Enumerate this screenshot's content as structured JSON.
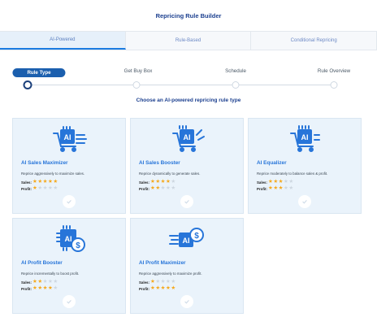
{
  "page_title": "Repricing Rule Builder",
  "tabs": [
    {
      "label": "AI-Powered",
      "active": true
    },
    {
      "label": "Rule-Based",
      "active": false
    },
    {
      "label": "Conditional Repricing",
      "active": false
    }
  ],
  "steps": [
    {
      "label": "Rule Type",
      "active": true
    },
    {
      "label": "Get Buy Box",
      "active": false
    },
    {
      "label": "Schedule",
      "active": false
    },
    {
      "label": "Rule Overview",
      "active": false
    }
  ],
  "subtitle": "Choose an AI-powered repricing rule type",
  "rating_labels": {
    "sales": "Sales:",
    "profit": "Profit:"
  },
  "cards": [
    {
      "name": "AI Sales Maximizer",
      "description": "Reprice aggressively to maximize sales.",
      "sales": 5,
      "profit": 1,
      "icon": "ai-cart-icon"
    },
    {
      "name": "AI Sales Booster",
      "description": "Reprice dynamically to generate sales.",
      "sales": 4,
      "profit": 2,
      "icon": "ai-cart-boost-icon"
    },
    {
      "name": "AI Equalizer",
      "description": "Reprice moderately to balance sales & profit.",
      "sales": 3,
      "profit": 3,
      "icon": "ai-cart-balance-icon"
    },
    {
      "name": "AI Profit Booster",
      "description": "Reprice incrementally to boost profit.",
      "sales": 2,
      "profit": 4,
      "icon": "ai-profit-coin-icon"
    },
    {
      "name": "AI Profit Maximizer",
      "description": "Reprice aggressively to maximize profit.",
      "sales": 1,
      "profit": 5,
      "icon": "ai-profit-chip-icon"
    }
  ],
  "colors": {
    "accent": "#1b5fae",
    "icon": "#2775d9",
    "star": "#f5a81b",
    "card_bg": "#eaf3fb"
  }
}
